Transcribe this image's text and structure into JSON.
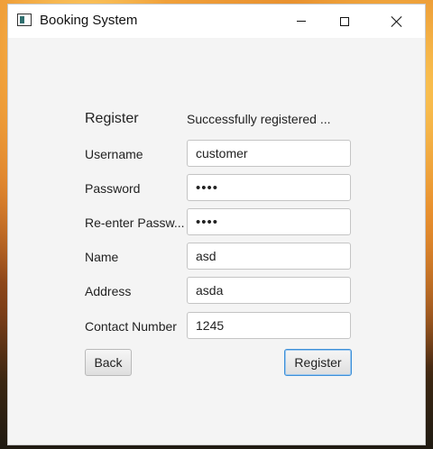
{
  "window": {
    "title": "Booking System"
  },
  "form": {
    "heading": "Register",
    "status": "Successfully registered ...",
    "fields": {
      "username": {
        "label": "Username",
        "value": "customer"
      },
      "password": {
        "label": "Password",
        "value": "••••"
      },
      "reenter_password": {
        "label": "Re-enter Passw...",
        "value": "••••"
      },
      "name": {
        "label": "Name",
        "value": "asd"
      },
      "address": {
        "label": "Address",
        "value": "asda"
      },
      "contact_number": {
        "label": "Contact Number",
        "value": "1245"
      }
    },
    "buttons": {
      "back": "Back",
      "register": "Register"
    }
  },
  "colors": {
    "window_bg": "#f4f4f4",
    "focus_accent": "#3d8fd8"
  }
}
